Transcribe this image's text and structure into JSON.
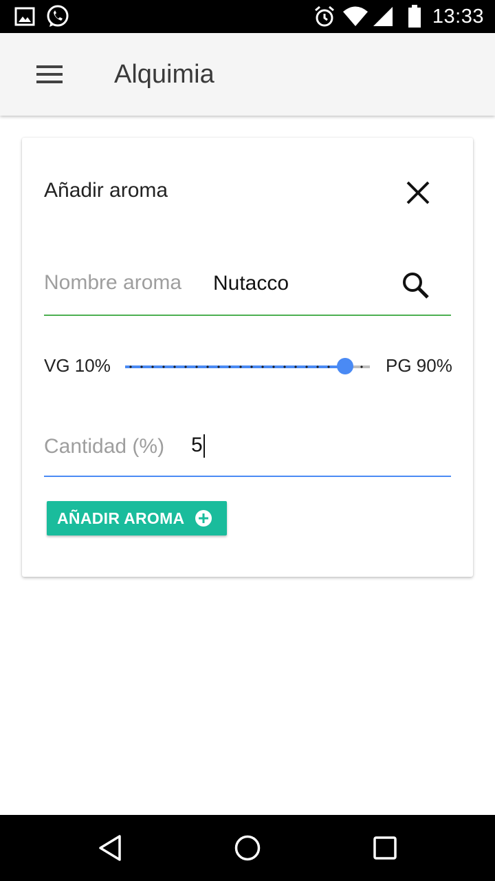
{
  "status_bar": {
    "time": "13:33",
    "left_icons": [
      "image-icon",
      "whatsapp-icon"
    ],
    "right_icons": [
      "alarm-icon",
      "wifi-icon",
      "signal-icon",
      "battery-icon"
    ]
  },
  "app_bar": {
    "title": "Alquimia",
    "menu_icon": "hamburger-menu-icon"
  },
  "dialog": {
    "title": "Añadir aroma",
    "close_icon": "close-icon",
    "name_field": {
      "label": "Nombre aroma",
      "value": "Nutacco",
      "search_icon": "search-icon",
      "underline_color": "#4caf50"
    },
    "ratio": {
      "vg_label": "VG 10%",
      "pg_label": "PG 90%",
      "pg_fraction": 0.9,
      "accent_color": "#4a8af4"
    },
    "quantity_field": {
      "label": "Cantidad (%)",
      "value": "5",
      "underline_color": "#4a8af4"
    },
    "add_button": {
      "label": "AÑADIR AROMA",
      "icon": "plus-circle-icon",
      "color": "#1abc9c"
    }
  },
  "nav_bar": {
    "icons": [
      "back-icon",
      "home-icon",
      "recents-icon"
    ]
  }
}
